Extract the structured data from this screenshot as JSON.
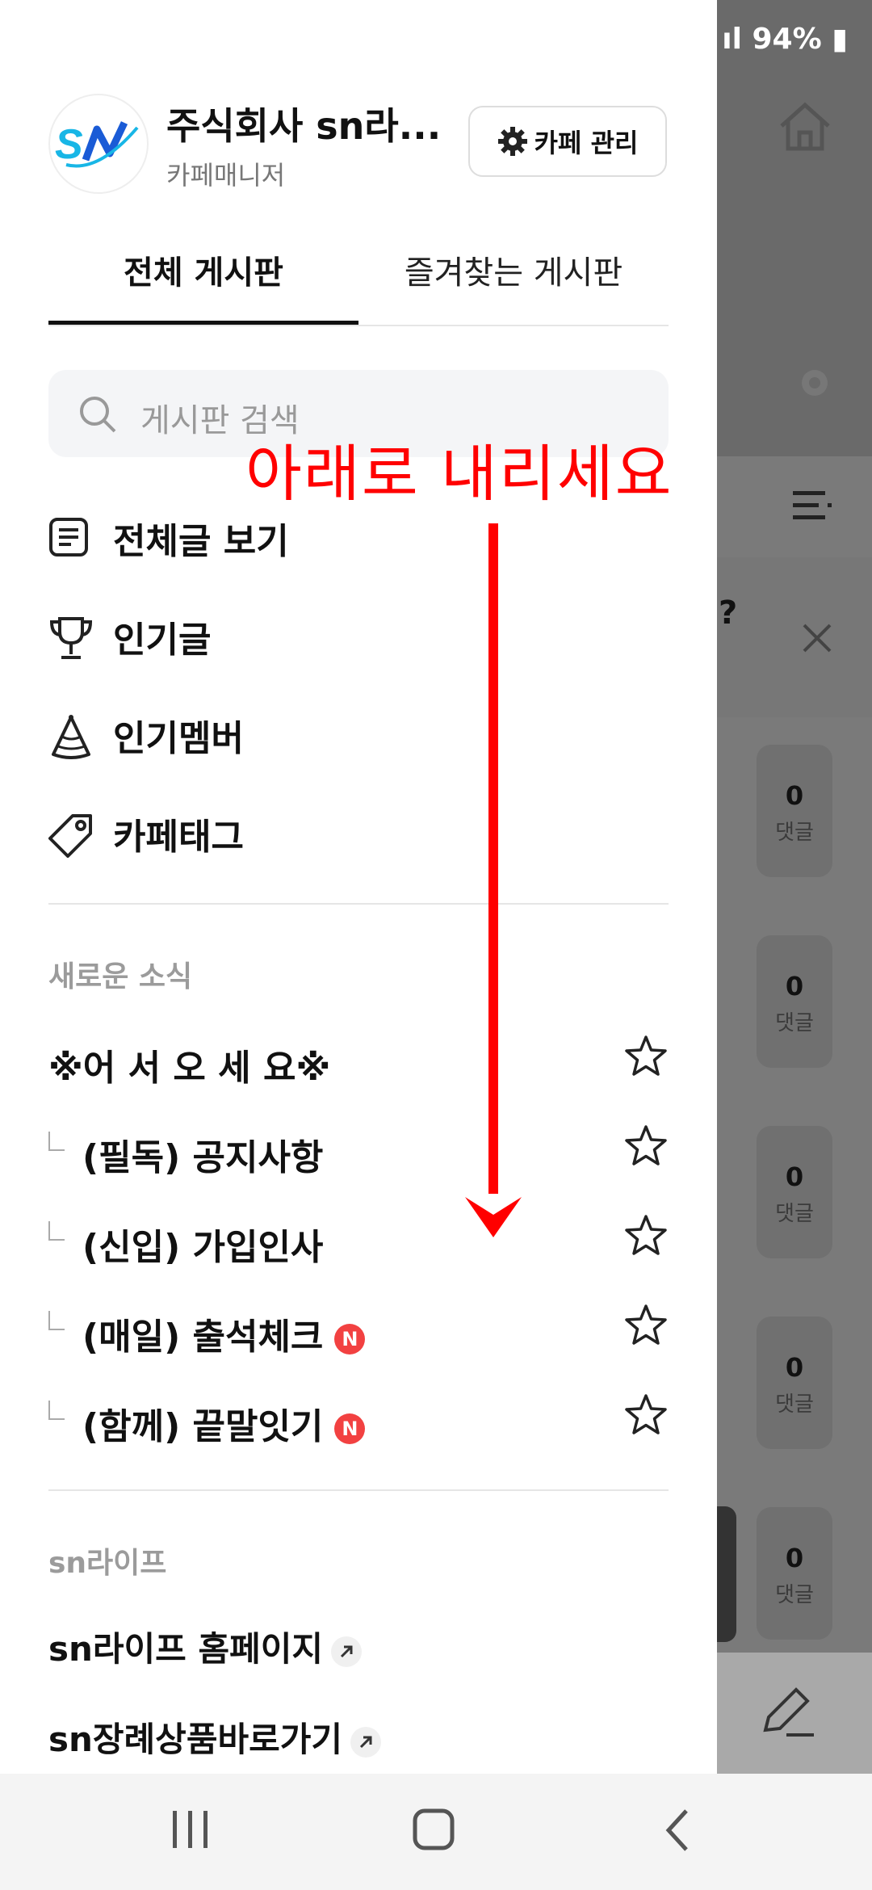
{
  "status_bar": {
    "battery": "94%"
  },
  "cafe": {
    "name": "주식회사 sn라...",
    "role": "카페매니저",
    "manage_label": "카페 관리"
  },
  "tabs": [
    {
      "label": "전체 게시판",
      "active": true
    },
    {
      "label": "즐겨찾는 게시판",
      "active": false
    }
  ],
  "search": {
    "placeholder": "게시판 검색"
  },
  "menu": [
    {
      "label": "전체글 보기",
      "icon": "list-document-icon"
    },
    {
      "label": "인기글",
      "icon": "trophy-icon"
    },
    {
      "label": "인기멤버",
      "icon": "party-hat-icon"
    },
    {
      "label": "카페태그",
      "icon": "tag-icon"
    }
  ],
  "sections": [
    {
      "title": "새로운 소식",
      "boards": [
        {
          "label": "※어 서 오 세 요※",
          "child": false,
          "new": false
        },
        {
          "label": "(필독) 공지사항",
          "child": true,
          "new": false
        },
        {
          "label": "(신입) 가입인사",
          "child": true,
          "new": false
        },
        {
          "label": "(매일) 출석체크",
          "child": true,
          "new": true
        },
        {
          "label": "(함께) 끝말잇기",
          "child": true,
          "new": true
        }
      ]
    },
    {
      "title": "sn라이프",
      "links": [
        {
          "label": "sn라이프 홈페이지"
        },
        {
          "label": "sn장례상품바로가기"
        }
      ]
    }
  ],
  "new_badge": "N",
  "annotation": "아래로  내리세요",
  "background": {
    "question_mark": "?",
    "comments": [
      {
        "count": "0",
        "label": "댓글"
      },
      {
        "count": "0",
        "label": "댓글"
      },
      {
        "count": "0",
        "label": "댓글"
      },
      {
        "count": "0",
        "label": "댓글"
      },
      {
        "count": "0",
        "label": "댓글"
      }
    ]
  },
  "colors": {
    "accent_red": "#ff0000",
    "badge_red": "#f24141",
    "logo_blue": "#1a5bd6",
    "logo_cyan": "#18b6e6"
  }
}
